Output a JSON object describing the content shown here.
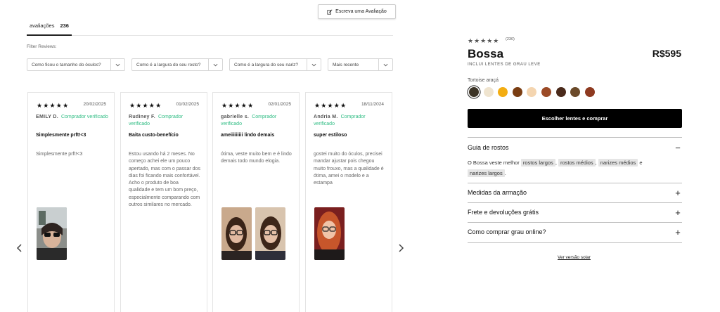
{
  "reviews": {
    "write_label": "Escreva uma Avaliação",
    "tab_label": "avaliações",
    "tab_count": "236",
    "filter_label": "Filter Reviews:",
    "filters": [
      "Como ficou o tamanho do óculos?",
      "Como é a largura do seu rosto?",
      "Como é a largura do seu nariz?",
      "Mais recente"
    ],
    "cards": [
      {
        "stars": "★★★★★",
        "date": "20/02/2025",
        "name": "EMILY D.",
        "verified": "Comprador verificado",
        "title": "Simplesmente prft!<3",
        "body": "Simplesmente prft!<3"
      },
      {
        "stars": "★★★★★",
        "date": "01/02/2025",
        "name": "Rudiney F.",
        "verified": "Comprador verificado",
        "title": "Baita custo-benefício",
        "body": "Estou usando há 2 meses. No começo achei ele um pouco apertado, mas com o passar dos dias foi ficando mais confortável. Acho o produto de boa qualidade e tem um bom preço, especialmente comparando com outros similares no mercado."
      },
      {
        "stars": "★★★★★",
        "date": "02/01/2025",
        "name": "gabrielle s.",
        "verified": "Comprador verificado",
        "title": "ameiiiiiiiii lindo demais",
        "body": "ótima, veste muito bem e é lindo demais todo mundo elogia."
      },
      {
        "stars": "★★★★★",
        "date": "18/11/2024",
        "name": "Andria M.",
        "verified": "Comprador verificado",
        "title": "super estiloso",
        "body": "gostei muito do óculos, precisei mandar ajustar pois chegou muito frouxo, mas a qualidade é ótima, amei o modelo e a estampa"
      }
    ]
  },
  "product": {
    "stars": "★★★★★",
    "rating_count": "(230)",
    "name": "Bossa",
    "price": "R$595",
    "subtitle": "INCLUI LENTES DE GRAU LEVE",
    "color_label": "Tortoise araçá",
    "swatch_colors": [
      "#3b3326",
      "#efe4cf",
      "#f3ad12",
      "#7a3d12",
      "#f4d5b0",
      "#9b4a26",
      "#4a2a1b",
      "#6b4a2a",
      "#8e3a20"
    ],
    "buy_label": "Escolher lentes e comprar",
    "accordion": [
      {
        "label": "Guia de rostos",
        "sign": "−"
      },
      {
        "label": "Medidas da armação",
        "sign": "+"
      },
      {
        "label": "Frete e devoluções grátis",
        "sign": "+"
      },
      {
        "label": "Como comprar grau online?",
        "sign": "+"
      }
    ],
    "faces_intro": "O Bossa veste melhor",
    "faces_chips": [
      "rostos largos",
      "rostos médios",
      "narizes médios",
      "narizes largos"
    ],
    "faces_and": "e",
    "solar_link": "Ver versão solar"
  }
}
